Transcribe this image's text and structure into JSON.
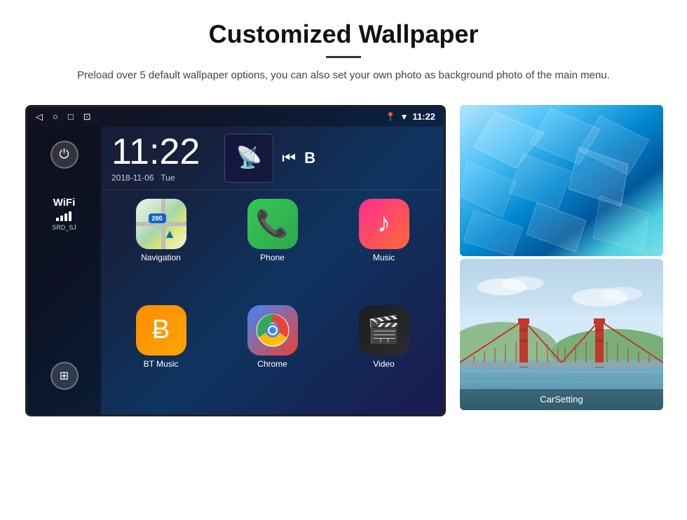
{
  "header": {
    "title": "Customized Wallpaper",
    "description": "Preload over 5 default wallpaper options, you can also set your own photo as background photo of the main menu."
  },
  "device": {
    "status_bar": {
      "time": "11:22",
      "nav_icons": [
        "◁",
        "○",
        "□",
        "⊡"
      ],
      "status_icons": [
        "📍",
        "▼"
      ]
    },
    "clock": {
      "time": "11:22",
      "date": "2018-11-06",
      "day": "Tue"
    },
    "sidebar": {
      "power_label": "⏻",
      "wifi_label": "WiFi",
      "wifi_name": "SRD_SJ",
      "apps_label": "⊞"
    },
    "apps": [
      {
        "id": "navigation",
        "label": "Navigation",
        "icon_type": "map"
      },
      {
        "id": "phone",
        "label": "Phone",
        "icon_type": "phone"
      },
      {
        "id": "music",
        "label": "Music",
        "icon_type": "music"
      },
      {
        "id": "bt-music",
        "label": "BT Music",
        "icon_type": "bluetooth"
      },
      {
        "id": "chrome",
        "label": "Chrome",
        "icon_type": "chrome"
      },
      {
        "id": "video",
        "label": "Video",
        "icon_type": "video"
      }
    ]
  },
  "wallpapers": [
    {
      "id": "ice",
      "alt": "Ice blue wallpaper"
    },
    {
      "id": "bridge",
      "alt": "Golden Gate Bridge wallpaper",
      "label": "CarSetting"
    }
  ]
}
